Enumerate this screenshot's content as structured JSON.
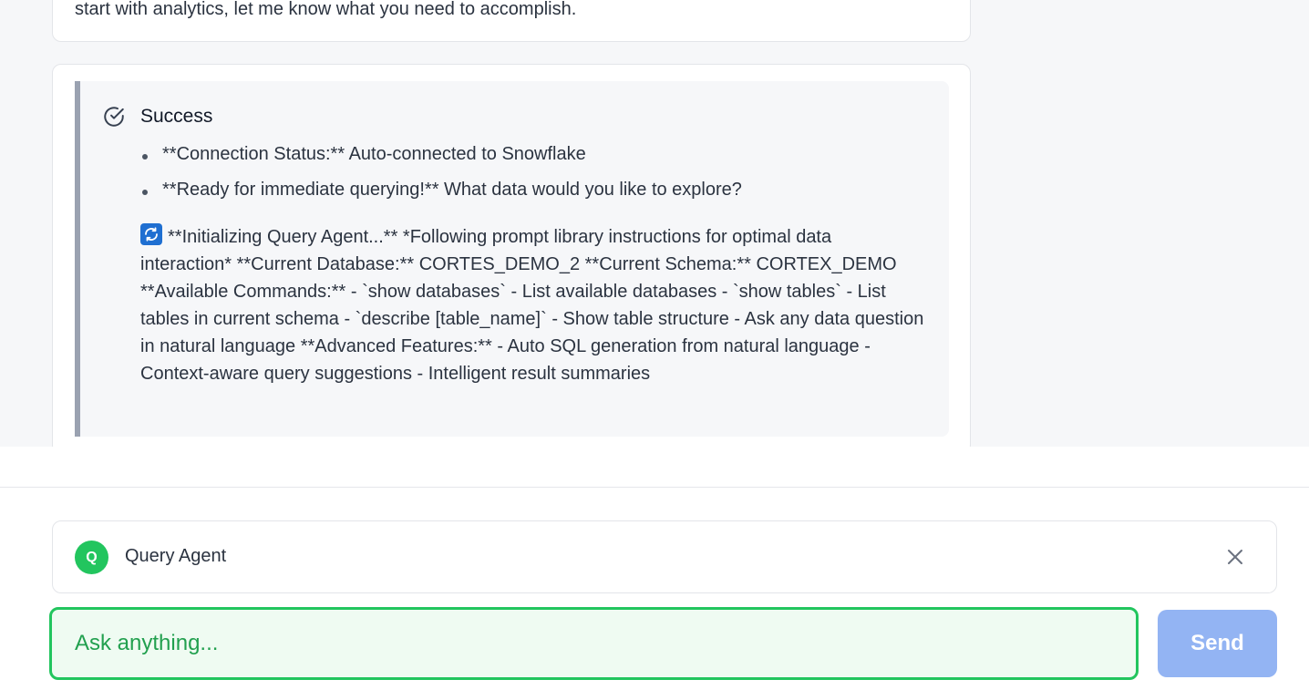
{
  "previous_message": {
    "text": "start with analytics, let me know what you need to accomplish."
  },
  "alert": {
    "icon": "check-circle-icon",
    "title": "Success",
    "bullets": [
      "**Connection Status:** Auto-connected to Snowflake",
      "**Ready for immediate querying!** What data would you like to explore?"
    ],
    "body_icon": "refresh-icon",
    "body": "**Initializing Query Agent...** *Following prompt library instructions for optimal data interaction* **Current Database:** CORTES_DEMO_2 **Current Schema:** CORTEX_DEMO **Available Commands:** - `show databases` - List available databases - `show tables` - List tables in current schema - `describe [table_name]` - Show table structure - Ask any data question in natural language **Advanced Features:** - Auto SQL generation from natural language - Context-aware query suggestions - Intelligent result summaries"
  },
  "agent": {
    "avatar_letter": "Q",
    "name": "Query Agent"
  },
  "composer": {
    "placeholder": "Ask anything...",
    "send_label": "Send"
  },
  "colors": {
    "accent_green": "#22c55e",
    "send_button": "#93b4f3",
    "alert_border": "#9aa2b1"
  }
}
